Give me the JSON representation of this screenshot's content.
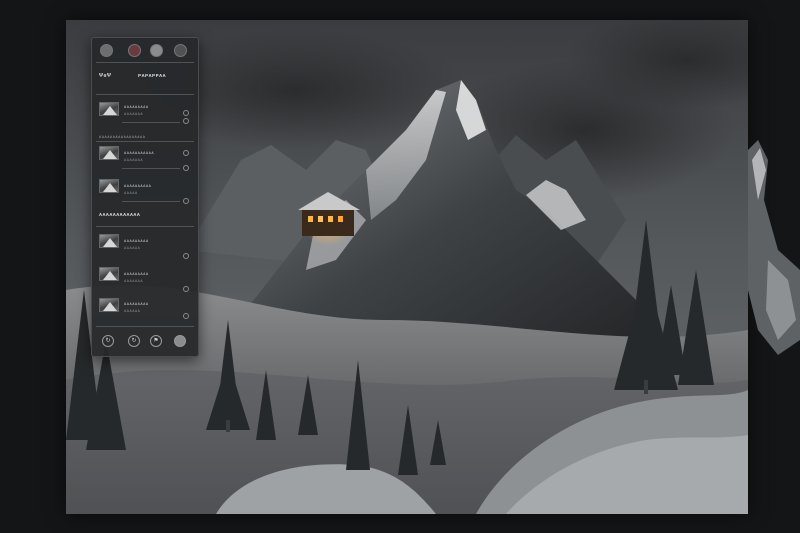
{
  "panel": {
    "title": "ΨϭΨ",
    "title_right": "ᴘᴀᴘᴀᴘᴘᴀᴀ",
    "top_icons": [
      "mountain-icon",
      "photo-icon",
      "globe-icon",
      "cloud-icon"
    ],
    "section_a": [
      {
        "label": "ᴀᴀᴀᴀᴀᴀᴀᴀᴀ",
        "sub": "ᴀᴀᴀᴀᴀᴀᴀ",
        "icon": "settings-icon"
      },
      {
        "label": "ᴀᴀᴀᴀᴀᴀᴀᴀᴀ",
        "sub": "ᴀᴀᴀᴀᴀ",
        "icon": "refresh-icon"
      }
    ],
    "section_a_label": "ᴀᴀᴀᴀᴀᴀᴀᴀᴀᴀᴀᴀᴀᴀᴀᴀᴀ",
    "section_b": [
      {
        "label": "ᴀᴀᴀᴀᴀᴀᴀᴀᴀᴀᴀ",
        "sub": "ᴀᴀᴀᴀᴀᴀᴀ",
        "icon": "edit-icon"
      },
      {
        "label": "ᴀᴀᴀᴀᴀᴀᴀᴀᴀᴀ",
        "sub": "ᴀᴀᴀᴀᴀ",
        "icon": "info-icon"
      }
    ],
    "section_c_label": "ᴀᴀᴀᴀᴀᴀᴀᴀᴀᴀᴀᴀ",
    "section_c": [
      {
        "label": "ᴀᴀᴀᴀᴀᴀᴀᴀᴀ",
        "sub": "ᴀᴀᴀᴀᴀᴀ",
        "icon": "share-icon"
      },
      {
        "label": "ᴀᴀᴀᴀᴀᴀᴀᴀᴀ",
        "sub": "ᴀᴀᴀᴀᴀᴀᴀ",
        "icon": "star-icon"
      },
      {
        "label": "ᴀᴀᴀᴀᴀᴀᴀᴀᴀ",
        "sub": "ᴀᴀᴀᴀᴀᴀ",
        "icon": "export-icon"
      }
    ],
    "bottom_buttons": [
      {
        "glyph": "↻",
        "icon": "undo-icon"
      },
      {
        "glyph": "↻",
        "icon": "redo-icon"
      },
      {
        "glyph": "⚑",
        "icon": "flag-icon"
      },
      {
        "glyph": "",
        "icon": "color-swatch-icon"
      }
    ]
  },
  "colors": {
    "panel_bg": "#26282a",
    "window_glow": "#f0a040",
    "sky": "#55585b"
  }
}
